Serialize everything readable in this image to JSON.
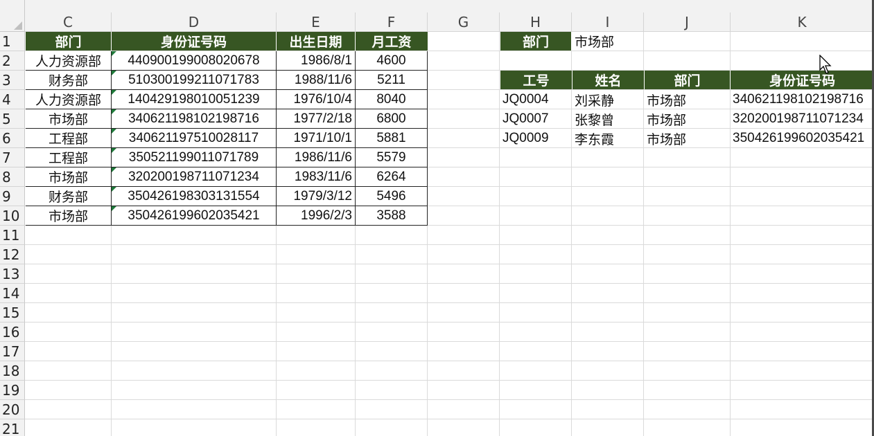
{
  "columns": [
    "C",
    "D",
    "E",
    "F",
    "G",
    "H",
    "I",
    "J",
    "K"
  ],
  "rows": [
    "1",
    "2",
    "3",
    "4",
    "5",
    "6",
    "7",
    "8",
    "9",
    "10",
    "11",
    "12",
    "13",
    "14",
    "15",
    "16",
    "17",
    "18",
    "19",
    "20",
    "21"
  ],
  "left_table": {
    "headers": [
      "部门",
      "身份证号码",
      "出生日期",
      "月工资"
    ],
    "rows": [
      [
        "人力资源部",
        "440900199008020678",
        "1986/8/1",
        "4600"
      ],
      [
        "财务部",
        "510300199211071783",
        "1988/11/6",
        "5211"
      ],
      [
        "人力资源部",
        "140429198010051239",
        "1976/10/4",
        "8040"
      ],
      [
        "市场部",
        "340621198102198716",
        "1977/2/18",
        "6800"
      ],
      [
        "工程部",
        "340621197510028117",
        "1971/10/1",
        "5881"
      ],
      [
        "工程部",
        "350521199011071789",
        "1986/11/6",
        "5579"
      ],
      [
        "市场部",
        "320200198711071234",
        "1983/11/6",
        "6264"
      ],
      [
        "财务部",
        "350426198303131554",
        "1979/3/12",
        "5496"
      ],
      [
        "市场部",
        "350426199602035421",
        "1996/2/3",
        "3588"
      ]
    ]
  },
  "filter": {
    "label": "部门",
    "value": "市场部"
  },
  "result_table": {
    "headers": [
      "工号",
      "姓名",
      "部门",
      "身份证号码"
    ],
    "rows": [
      [
        "JQ0004",
        "刘采静",
        "市场部",
        "340621198102198716"
      ],
      [
        "JQ0007",
        "张黎曾",
        "市场部",
        "320200198711071234"
      ],
      [
        "JQ0009",
        "李东霞",
        "市场部",
        "350426199602035421"
      ]
    ]
  },
  "colors": {
    "header_fill": "#375623",
    "header_text": "#ffffff",
    "error_triangle": "#1f7a3a"
  }
}
